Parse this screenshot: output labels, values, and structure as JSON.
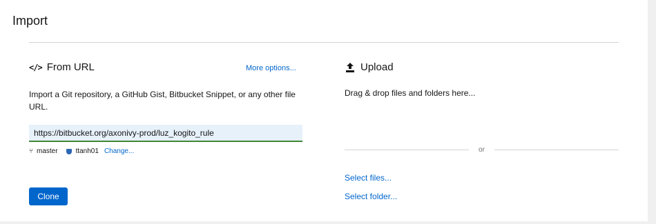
{
  "page": {
    "title": "Import"
  },
  "from_url": {
    "icon": "code-icon",
    "title": "From URL",
    "more_options": "More options...",
    "description": "Import a Git repository, a GitHub Gist, Bitbucket Snippet, or any other file URL.",
    "url_value": "https://bitbucket.org/axonivy-prod/luz_kogito_rule",
    "branch": "master",
    "user": "ttanh01",
    "change_label": "Change...",
    "clone_label": "Clone"
  },
  "upload": {
    "icon": "upload-icon",
    "title": "Upload",
    "drag_text": "Drag & drop files and folders here...",
    "or_text": "or",
    "select_files": "Select files...",
    "select_folder": "Select folder..."
  },
  "colors": {
    "accent": "#0066cc",
    "input_bg": "#e7f1fa",
    "input_valid_border": "#3e8635"
  }
}
